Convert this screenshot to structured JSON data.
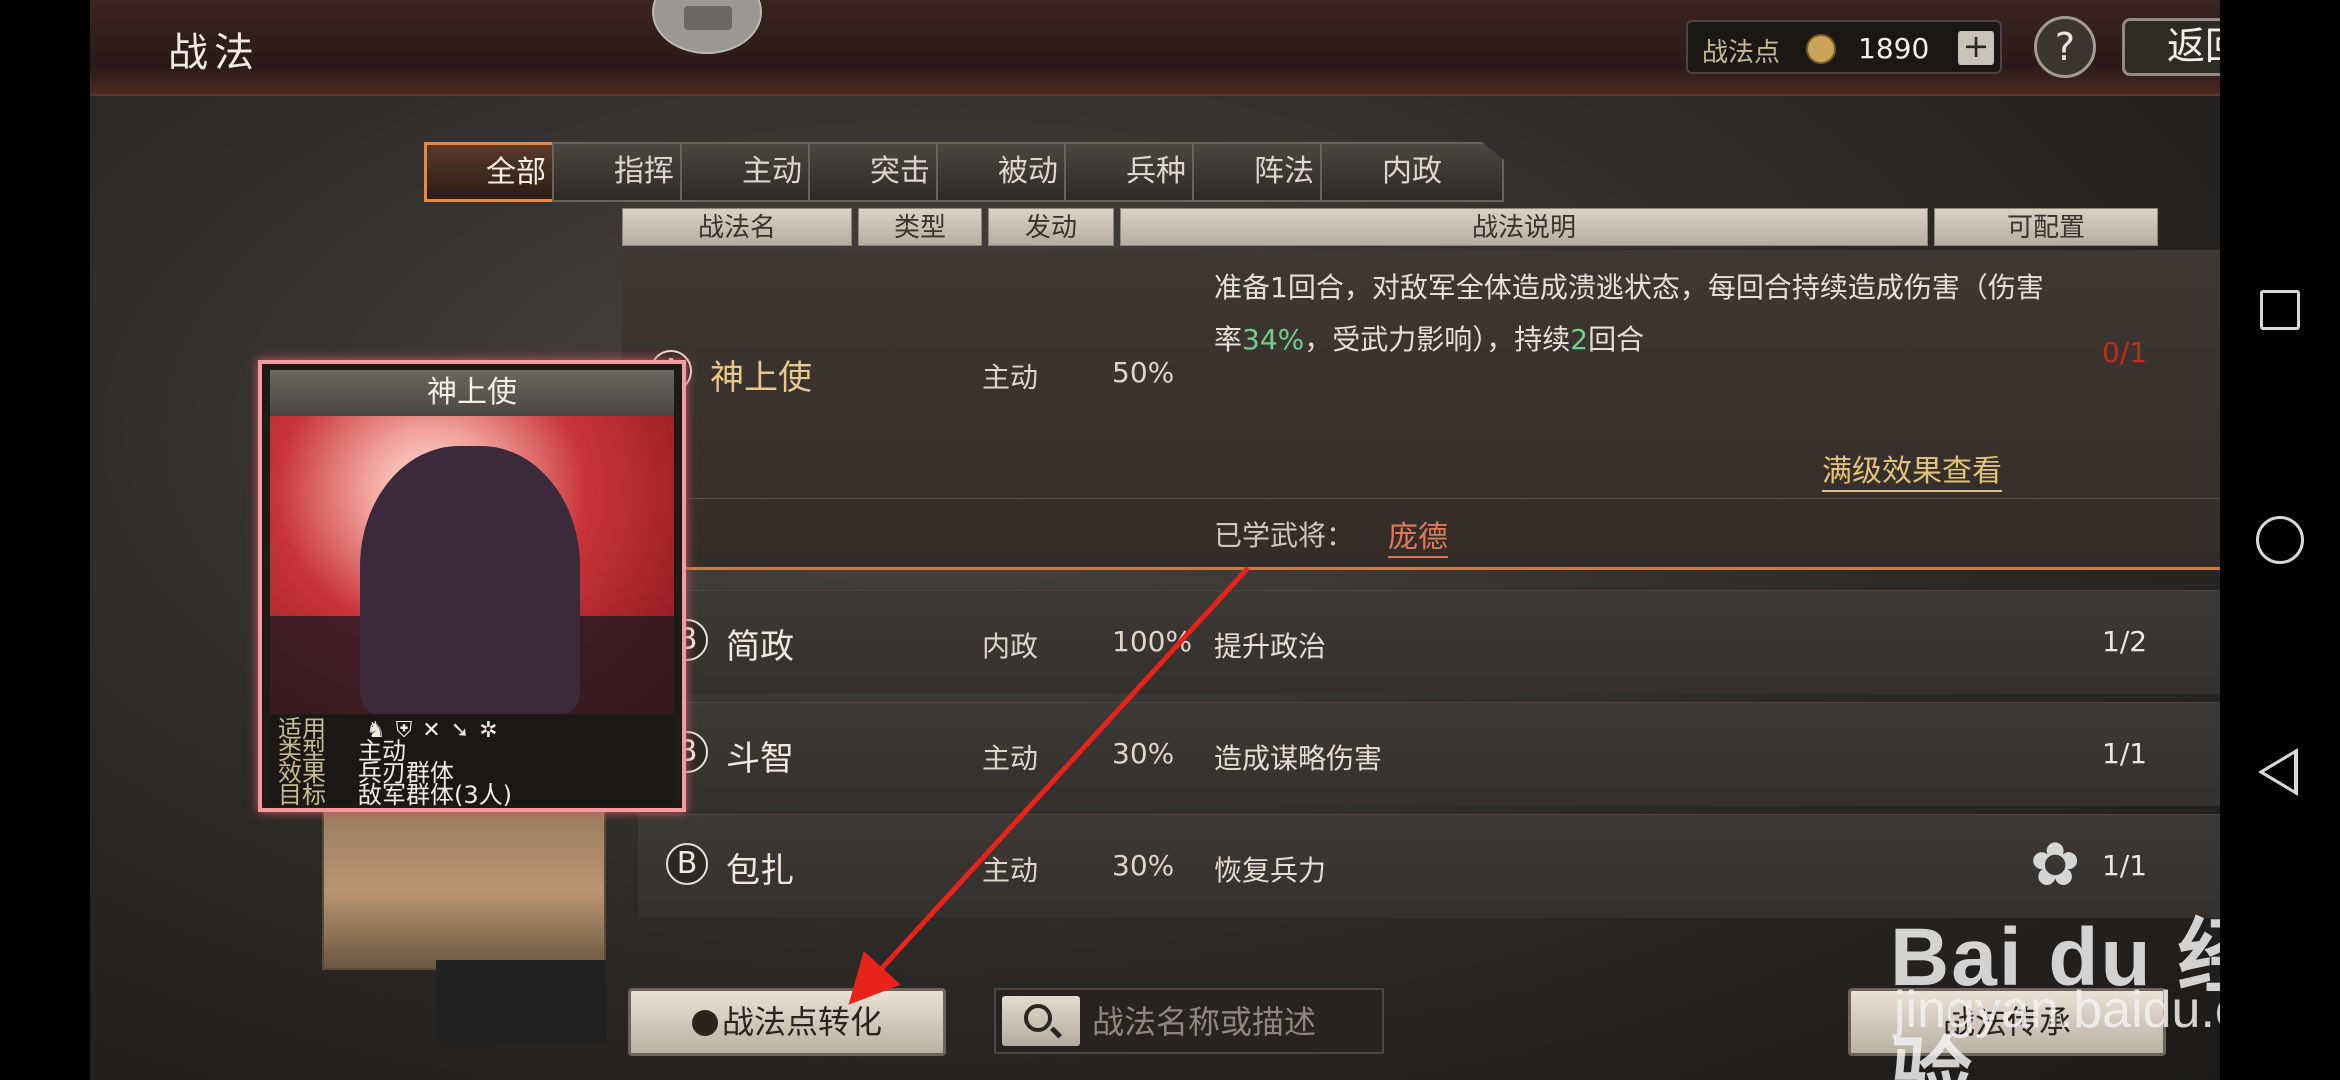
{
  "header": {
    "title": "战法",
    "points_label": "战法点",
    "points_value": "1890",
    "plus_label": "+",
    "help_label": "?",
    "back_label": "返回"
  },
  "tabs": [
    {
      "label": "全部",
      "active": true
    },
    {
      "label": "指挥"
    },
    {
      "label": "主动"
    },
    {
      "label": "突击"
    },
    {
      "label": "被动"
    },
    {
      "label": "兵种"
    },
    {
      "label": "阵法"
    },
    {
      "label": "内政"
    }
  ],
  "columns": {
    "name": "战法名",
    "type": "类型",
    "rate": "发动",
    "desc": "战法说明",
    "config": "可配置"
  },
  "selected_skill": {
    "grade": "A",
    "name": "神上使",
    "type": "主动",
    "rate": "50%",
    "desc_part1": "准备1回合，对敌军全体造成溃逃状态，每回合持续造成伤害（伤害率",
    "desc_highlight": "34%",
    "desc_part2": "，受武力影响），持续",
    "desc_highlight2": "2",
    "desc_part3": "回合",
    "count": "0/1",
    "full_effect_link": "满级效果查看",
    "learned_label": "已学武将：",
    "learned_general": "庞德"
  },
  "skills": [
    {
      "grade": "B",
      "name": "简政",
      "type": "内政",
      "rate": "100%",
      "desc": "提升政治",
      "count": "1/2"
    },
    {
      "grade": "B",
      "name": "斗智",
      "type": "主动",
      "rate": "30%",
      "desc": "造成谋略伤害",
      "count": "1/1"
    },
    {
      "grade": "B",
      "name": "包扎",
      "type": "主动",
      "rate": "30%",
      "desc": "恢复兵力",
      "count": "1/1"
    }
  ],
  "card": {
    "name": "神上使",
    "apply_key": "适用",
    "type_key": "类型",
    "type_val": "主动",
    "effect_key": "效果",
    "effect_val": "兵刃群体",
    "target_key": "目标",
    "target_val": "敌军群体(3人)",
    "troop_icons": [
      "cavalry-icon",
      "shield-icon",
      "bow-icon",
      "spear-icon",
      "wheel-icon"
    ]
  },
  "bottom": {
    "convert_label": "战法点转化",
    "search_placeholder": "战法名称或描述",
    "inherit_label": "战法传承"
  },
  "watermark": {
    "main": "Bai du 经验",
    "sub": "jingyan.baidu.com"
  },
  "colors": {
    "accent": "#e0894a",
    "grade_red": "#c8291e",
    "highlight_green": "#6fcf86",
    "link_gold": "#e2c27a",
    "general_orange": "#e0795a"
  }
}
